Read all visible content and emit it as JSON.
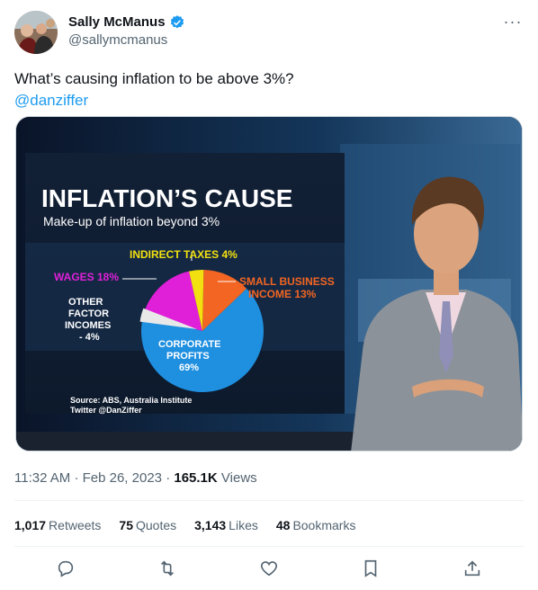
{
  "tweet": {
    "display_name": "Sally McManus",
    "handle": "@sallymcmanus",
    "text": "What’s causing inflation to be above 3%?",
    "mention": "@danziffer",
    "time": "11:32 AM",
    "date": "Feb 26, 2023",
    "views_count": "165.1K",
    "views_label": "Views"
  },
  "stats": {
    "retweets_count": "1,017",
    "retweets_label": "Retweets",
    "quotes_count": "75",
    "quotes_label": "Quotes",
    "likes_count": "3,143",
    "likes_label": "Likes",
    "bookmarks_count": "48",
    "bookmarks_label": "Bookmarks"
  },
  "media": {
    "title": "INFLATION’S CAUSE",
    "subtitle": "Make-up of inflation beyond 3%",
    "source_line1": "Source: ABS, Australia Institute",
    "source_line2": "Twitter @DanZiffer",
    "labels": {
      "indirect": "INDIRECT TAXES 4%",
      "wages": "WAGES 18%",
      "small1": "SMALL BUSINESS",
      "small2": "INCOME 13%",
      "other1": "OTHER",
      "other2": "FACTOR",
      "other3": "INCOMES",
      "other4": "- 4%",
      "corp1": "CORPORATE",
      "corp2": "PROFITS",
      "corp3": "69%"
    }
  },
  "chart_data": {
    "type": "pie",
    "title": "INFLATION’S CAUSE",
    "subtitle": "Make-up of inflation beyond 3%",
    "categories": [
      "Corporate profits",
      "Wages",
      "Small business income",
      "Indirect taxes",
      "Other factor incomes"
    ],
    "values": [
      69,
      18,
      13,
      4,
      -4
    ],
    "colors": [
      "#1f8fe0",
      "#e020d8",
      "#f26522",
      "#f2e010",
      "#e8e8e8"
    ]
  },
  "icons": [
    "verified-badge-icon",
    "more-icon",
    "reply-icon",
    "retweet-icon",
    "like-icon",
    "bookmark-icon",
    "share-icon"
  ]
}
